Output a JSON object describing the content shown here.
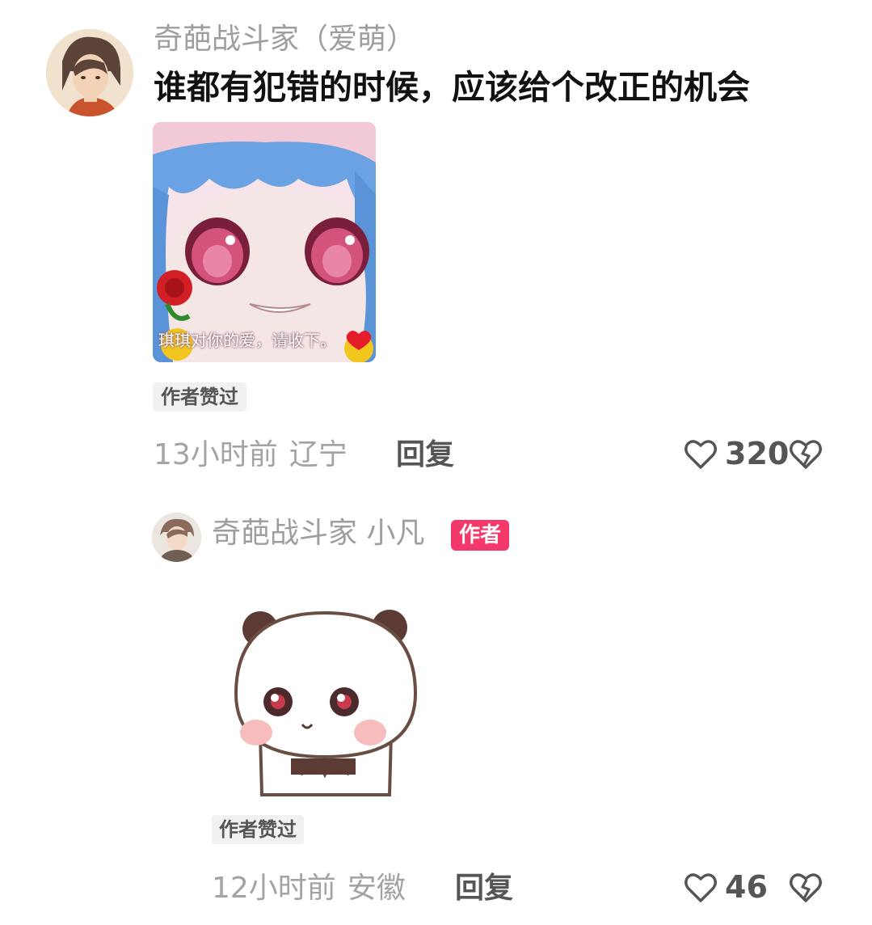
{
  "colors": {
    "username": "#9e9e9e",
    "text": "#111111",
    "meta": "#a3a3a3",
    "action": "#555555",
    "author_badge": "#f4386a",
    "tag_bg": "#f1f1f1"
  },
  "comment": {
    "username": "奇葩战斗家（爱萌）",
    "text": "谁都有犯错的时候，应该给个改正的机会",
    "sticker": {
      "icon": "anime-girl-sticker",
      "caption": "琪琪对你的爱，请收下。"
    },
    "author_liked": "作者赞过",
    "time": "13小时前",
    "region": "辽宁",
    "reply_label": "回复",
    "like_count": "320",
    "like_icon": "heart-outline-icon",
    "dislike_icon": "broken-heart-icon"
  },
  "reply": {
    "username": "奇葩战斗家 小凡",
    "author_badge": "作者",
    "sticker": {
      "icon": "panda-sticker"
    },
    "author_liked": "作者赞过",
    "time": "12小时前",
    "region": "安徽",
    "reply_label": "回复",
    "like_count": "46",
    "like_icon": "heart-outline-icon",
    "dislike_icon": "broken-heart-icon"
  }
}
